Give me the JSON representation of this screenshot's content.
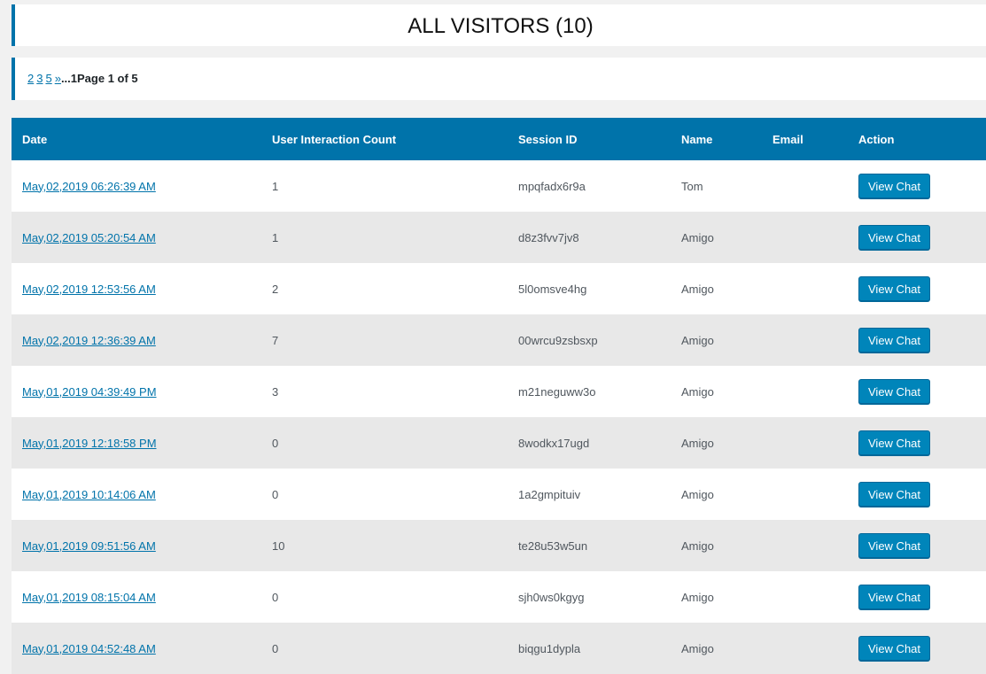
{
  "header": {
    "title": "ALL VISITORS (10)"
  },
  "pagination": {
    "pages": [
      "2",
      "3",
      "5",
      "»"
    ],
    "ellipsis": "...",
    "current": "1",
    "info": "Page 1 of 5"
  },
  "table": {
    "columns": [
      "Date",
      "User Interaction Count",
      "Session ID",
      "Name",
      "Email",
      "Action"
    ],
    "rows": [
      {
        "date": "May,02,2019 06:26:39 AM",
        "count": "1",
        "session": "mpqfadx6r9a",
        "name": "Tom",
        "email": "",
        "action": "View Chat"
      },
      {
        "date": "May,02,2019 05:20:54 AM",
        "count": "1",
        "session": "d8z3fvv7jv8",
        "name": "Amigo",
        "email": "",
        "action": "View Chat"
      },
      {
        "date": "May,02,2019 12:53:56 AM",
        "count": "2",
        "session": "5l0omsve4hg",
        "name": "Amigo",
        "email": "",
        "action": "View Chat"
      },
      {
        "date": "May,02,2019 12:36:39 AM",
        "count": "7",
        "session": "00wrcu9zsbsxp",
        "name": "Amigo",
        "email": "",
        "action": "View Chat"
      },
      {
        "date": "May,01,2019 04:39:49 PM",
        "count": "3",
        "session": "m21neguww3o",
        "name": "Amigo",
        "email": "",
        "action": "View Chat"
      },
      {
        "date": "May,01,2019 12:18:58 PM",
        "count": "0",
        "session": "8wodkx17ugd",
        "name": "Amigo",
        "email": "",
        "action": "View Chat"
      },
      {
        "date": "May,01,2019 10:14:06 AM",
        "count": "0",
        "session": "1a2gmpituiv",
        "name": "Amigo",
        "email": "",
        "action": "View Chat"
      },
      {
        "date": "May,01,2019 09:51:56 AM",
        "count": "10",
        "session": "te28u53w5un",
        "name": "Amigo",
        "email": "",
        "action": "View Chat"
      },
      {
        "date": "May,01,2019 08:15:04 AM",
        "count": "0",
        "session": "sjh0ws0kgyg",
        "name": "Amigo",
        "email": "",
        "action": "View Chat"
      },
      {
        "date": "May,01,2019 04:52:48 AM",
        "count": "0",
        "session": "biqgu1dypla",
        "name": "Amigo",
        "email": "",
        "action": "View Chat"
      }
    ]
  },
  "colors": {
    "accent": "#0073aa",
    "button": "#0085ba",
    "row_alt": "#e8e8e8"
  }
}
